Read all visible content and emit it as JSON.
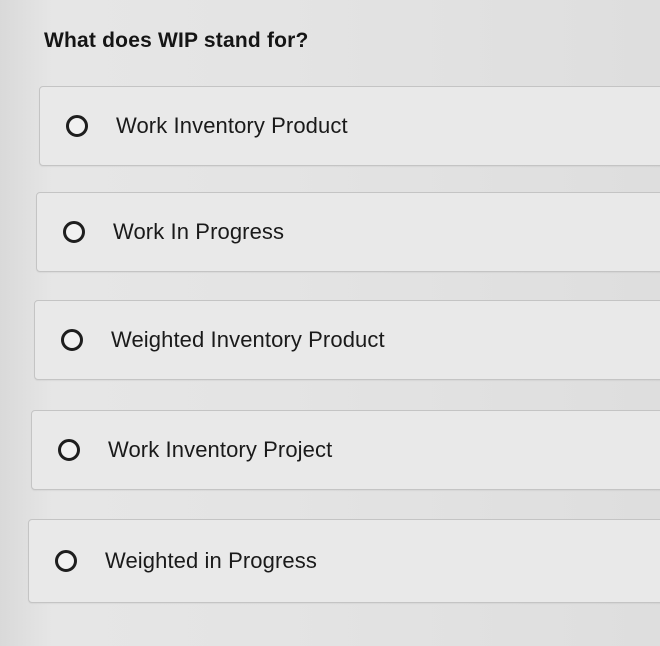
{
  "quiz": {
    "question": "What does WIP stand for?",
    "options": [
      {
        "label": "Work Inventory Product",
        "selected": false
      },
      {
        "label": "Work In Progress",
        "selected": false
      },
      {
        "label": "Weighted Inventory Product",
        "selected": false
      },
      {
        "label": "Work Inventory Project",
        "selected": false
      },
      {
        "label": "Weighted in Progress",
        "selected": false
      }
    ]
  }
}
